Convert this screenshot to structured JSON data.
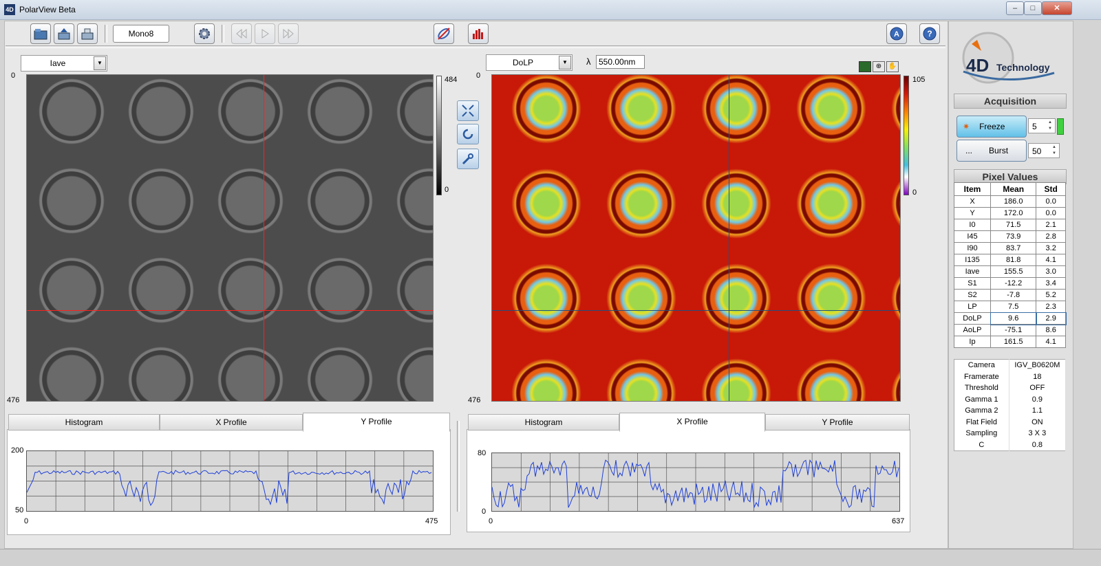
{
  "window": {
    "title": "PolarView Beta",
    "icon_text": "4D",
    "min": "–",
    "max": "□",
    "close": "✕"
  },
  "toolbar": {
    "format": "Mono8"
  },
  "left_view": {
    "select": "Iave",
    "y_top": "0",
    "y_bottom": "476",
    "cbar_max": "484",
    "cbar_min": "0"
  },
  "right_view": {
    "select": "DoLP",
    "lambda_symbol": "λ",
    "wavelength": "550.00nm",
    "y_top": "0",
    "y_bottom": "476",
    "cbar_max": "105",
    "cbar_min": "0"
  },
  "left_plot": {
    "tabs": [
      "Histogram",
      "X Profile",
      "Y Profile"
    ],
    "active_tab": 2,
    "y_max": "200",
    "y_min": "50",
    "x_min": "0",
    "x_max": "475"
  },
  "right_plot": {
    "tabs": [
      "Histogram",
      "X Profile",
      "Y Profile"
    ],
    "active_tab": 1,
    "y_max": "80",
    "y_min": "0",
    "x_min": "0",
    "x_max": "637"
  },
  "logo": {
    "text": "4D",
    "subtext": "Technology"
  },
  "acquisition": {
    "title": "Acquisition",
    "freeze_label": "Freeze",
    "freeze_value": "5",
    "burst_prefix": "...",
    "burst_label": "Burst",
    "burst_value": "50"
  },
  "pixel_values": {
    "title": "Pixel Values",
    "headers": [
      "Item",
      "Mean",
      "Std"
    ],
    "rows": [
      [
        "X",
        "186.0",
        "0.0"
      ],
      [
        "Y",
        "172.0",
        "0.0"
      ],
      [
        "I0",
        "71.5",
        "2.1"
      ],
      [
        "I45",
        "73.9",
        "2.8"
      ],
      [
        "I90",
        "83.7",
        "3.2"
      ],
      [
        "I135",
        "81.8",
        "4.1"
      ],
      [
        "Iave",
        "155.5",
        "3.0"
      ],
      [
        "S1",
        "-12.2",
        "3.4"
      ],
      [
        "S2",
        "-7.8",
        "5.2"
      ],
      [
        "LP",
        "7.5",
        "2.3"
      ],
      [
        "DoLP",
        "9.6",
        "2.9"
      ],
      [
        "AoLP",
        "-75.1",
        "8.6"
      ],
      [
        "Ip",
        "161.5",
        "4.1"
      ]
    ]
  },
  "info": {
    "rows": [
      [
        "Camera",
        "IGV_B0620M"
      ],
      [
        "Framerate",
        "18"
      ],
      [
        "Threshold",
        "OFF"
      ],
      [
        "Gamma 1",
        "0.9"
      ],
      [
        "Gamma 2",
        "1.1"
      ],
      [
        "Flat Field",
        "ON"
      ],
      [
        "Sampling",
        "3 X 3"
      ],
      [
        "C",
        "0.8"
      ]
    ]
  },
  "colors": {
    "accent": "#3a6ea5",
    "plot_line": "#1e3fd8",
    "crosshair": "#ff2020"
  }
}
